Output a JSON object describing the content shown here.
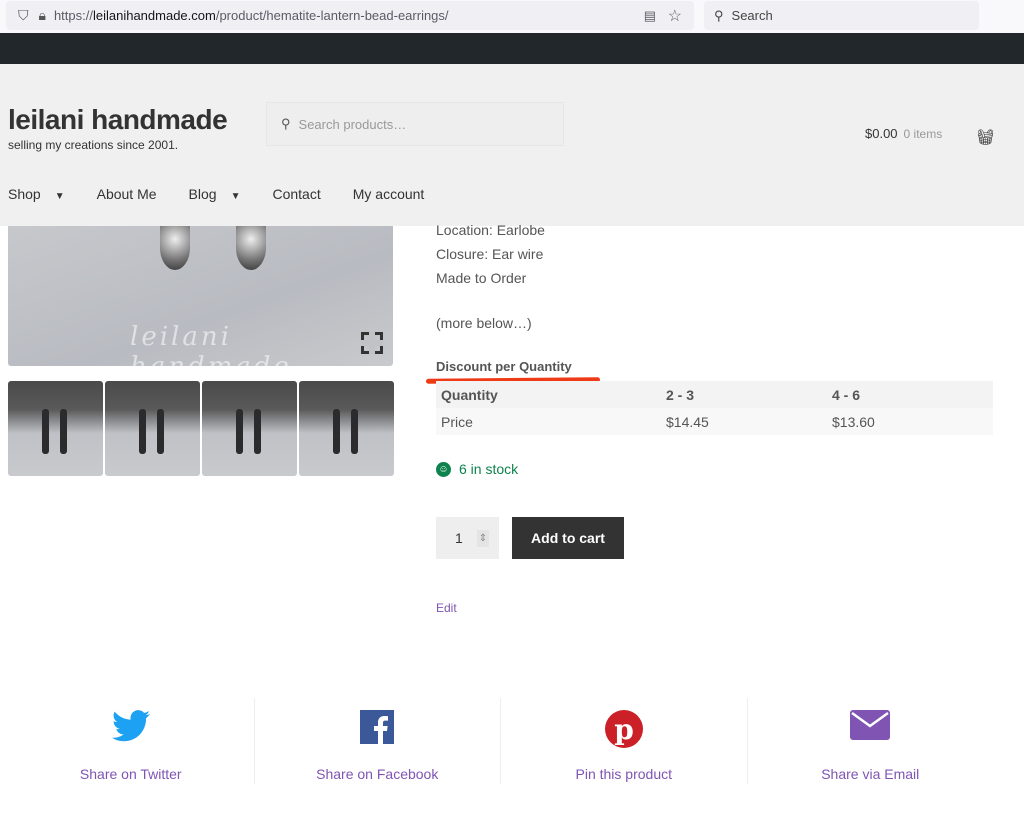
{
  "browser": {
    "url_prefix": "https://",
    "url_domain": "leilanihandmade.com",
    "url_path": "/product/hematite-lantern-bead-earrings/",
    "search_placeholder": "Search"
  },
  "site": {
    "title": "leilani handmade",
    "tagline": "selling my creations since 2001.",
    "search_placeholder": "Search products…",
    "cart_total": "$0.00",
    "cart_items": "0 items"
  },
  "nav": [
    {
      "label": "Shop",
      "dropdown": true
    },
    {
      "label": "About Me"
    },
    {
      "label": "Blog",
      "dropdown": true
    },
    {
      "label": "Contact"
    },
    {
      "label": "My account"
    }
  ],
  "gallery": {
    "watermark": "leilani handmade"
  },
  "product": {
    "details": [
      "Location: Earlobe",
      "Closure: Ear wire",
      "Made to Order"
    ],
    "more": "(more below…)",
    "discount_title": "Discount per Quantity",
    "discount_table": {
      "header": [
        "Quantity",
        "2 - 3",
        "4 - 6"
      ],
      "row": [
        "Price",
        "$14.45",
        "$13.60"
      ]
    },
    "stock": "6 in stock",
    "quantity": "1",
    "add_to_cart": "Add to cart",
    "edit": "Edit"
  },
  "share": [
    {
      "label": "Share on Twitter",
      "icon": "twitter-icon",
      "color": "#1da1f2"
    },
    {
      "label": "Share on Facebook",
      "icon": "facebook-icon",
      "color": "#3b5998"
    },
    {
      "label": "Pin this product",
      "icon": "pinterest-icon",
      "color": "#cb2027"
    },
    {
      "label": "Share via Email",
      "icon": "email-icon",
      "color": "#7f54b3"
    }
  ]
}
